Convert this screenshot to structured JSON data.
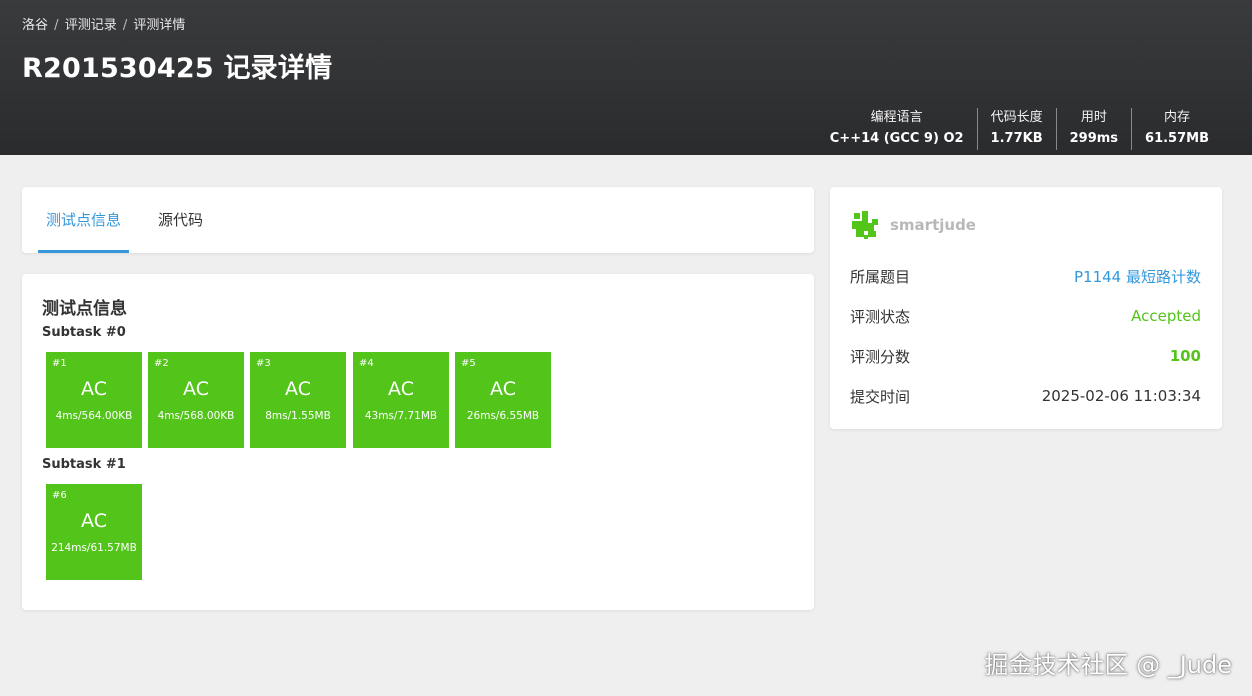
{
  "breadcrumb": {
    "items": [
      "洛谷",
      "评测记录",
      "评测详情"
    ],
    "separator": "/"
  },
  "page_title": "R201530425 记录详情",
  "stats": [
    {
      "label": "编程语言",
      "value": "C++14 (GCC 9) O2"
    },
    {
      "label": "代码长度",
      "value": "1.77KB"
    },
    {
      "label": "用时",
      "value": "299ms"
    },
    {
      "label": "内存",
      "value": "61.57MB"
    }
  ],
  "tabs": [
    {
      "label": "测试点信息",
      "active": true
    },
    {
      "label": "源代码",
      "active": false
    }
  ],
  "testcases_section": {
    "title": "测试点信息",
    "subtasks": [
      {
        "title": "Subtask #0",
        "cases": [
          {
            "num": "#1",
            "status": "AC",
            "detail": "4ms/564.00KB"
          },
          {
            "num": "#2",
            "status": "AC",
            "detail": "4ms/568.00KB"
          },
          {
            "num": "#3",
            "status": "AC",
            "detail": "8ms/1.55MB"
          },
          {
            "num": "#4",
            "status": "AC",
            "detail": "43ms/7.71MB"
          },
          {
            "num": "#5",
            "status": "AC",
            "detail": "26ms/6.55MB"
          }
        ]
      },
      {
        "title": "Subtask #1",
        "cases": [
          {
            "num": "#6",
            "status": "AC",
            "detail": "214ms/61.57MB"
          }
        ]
      }
    ]
  },
  "sidebar": {
    "username": "smartjude",
    "rows": [
      {
        "key": "所属题目",
        "value": "P1144 最短路计数"
      },
      {
        "key": "评测状态",
        "value": "Accepted"
      },
      {
        "key": "评测分数",
        "value": "100"
      },
      {
        "key": "提交时间",
        "value": "2025-02-06 11:03:34"
      }
    ]
  },
  "watermark": "掘金技术社区 @ _Jude",
  "colors": {
    "header_bg": "#2e2f31",
    "accent": "#3498db",
    "ac_green": "#52c41a",
    "page_bg": "#efefef"
  }
}
